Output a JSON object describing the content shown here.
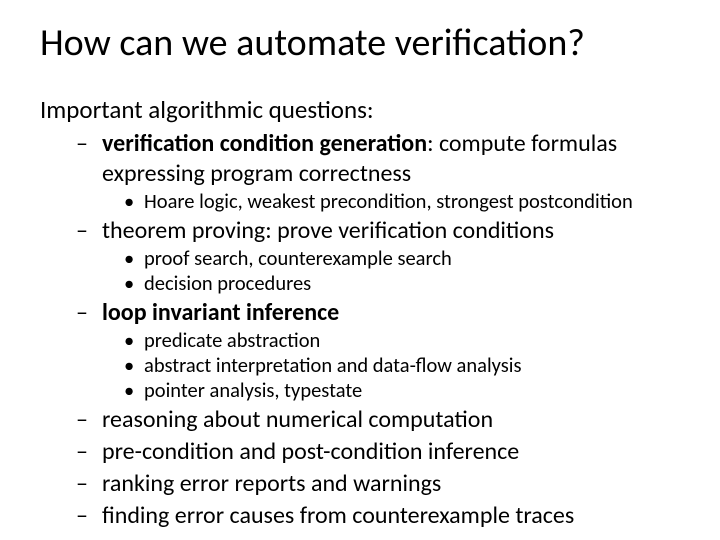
{
  "title": "How can we automate verification?",
  "intro": "Important algorithmic questions:",
  "items": [
    {
      "label_bold": "verification condition generation",
      "label_rest": ": compute formulas expressing program correctness",
      "sub": [
        "Hoare logic, weakest precondition, strongest postcondition"
      ]
    },
    {
      "label_plain": "theorem proving: prove verification conditions",
      "sub": [
        "proof search, counterexample search",
        "decision procedures"
      ]
    },
    {
      "label_bold": "loop invariant inference",
      "sub": [
        "predicate abstraction",
        "abstract interpretation and data-flow analysis",
        "pointer analysis, typestate"
      ]
    },
    {
      "label_plain": "reasoning about numerical computation"
    },
    {
      "label_plain": "pre-condition and post-condition inference"
    },
    {
      "label_plain": "ranking error reports and warnings"
    },
    {
      "label_plain": "finding error causes from counterexample traces"
    }
  ]
}
